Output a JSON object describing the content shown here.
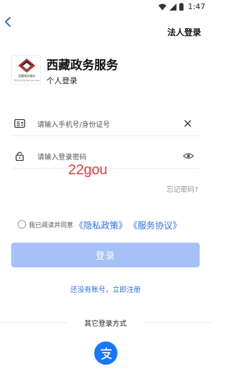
{
  "status_bar": {
    "time": "1:47"
  },
  "header": {
    "corp_login_label": "法人登录"
  },
  "brand": {
    "title": "西藏政务服务",
    "subtitle": "个人登录",
    "logo_caption": "西藏政务服务",
    "logo_subcaption": "སྲིད་དོན་ཞབས་ཞུ། Tibet Gov Service"
  },
  "form": {
    "phone_placeholder": "请输入手机号/身份证号",
    "password_placeholder": "请输入登录密码"
  },
  "watermark": "22gou",
  "forgot_password": "忘记密码?",
  "agreement": {
    "prefix": "我已阅读并同意",
    "privacy": "《隐私政策》",
    "service": "《服务协议》"
  },
  "login_button": "登录",
  "register_link": "还没有账号，立即注册",
  "other_login_title": "其它登录方式",
  "colors": {
    "accent": "#2f6fe4",
    "button_disabled": "#a6c1f5",
    "alipay": "#1677ff"
  }
}
